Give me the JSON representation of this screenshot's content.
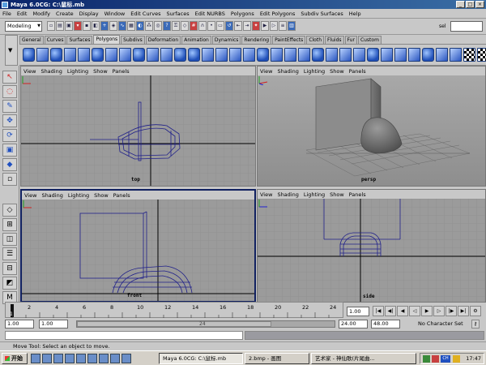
{
  "window": {
    "title": "Maya 6.0CG: C:\\鼠标.mb"
  },
  "menubar": [
    "File",
    "Edit",
    "Modify",
    "Create",
    "Display",
    "Window",
    "Edit Curves",
    "Surfaces",
    "Edit NURBS",
    "Polygons",
    "Edit Polygons",
    "Subdiv Surfaces",
    "Help"
  ],
  "statusline": {
    "mode": "Modeling",
    "selection_label": "sel"
  },
  "shelf": {
    "tabs": [
      "General",
      "Curves",
      "Surfaces",
      "Polygons",
      "Subdivs",
      "Deformation",
      "Animation",
      "Dynamics",
      "Rendering",
      "PaintEffects",
      "Cloth",
      "Fluids",
      "Fur",
      "Custom"
    ],
    "active_tab": "Polygons"
  },
  "viewport_menu": [
    "View",
    "Shading",
    "Lighting",
    "Show",
    "Panels"
  ],
  "viewports": {
    "top": {
      "camera": "top"
    },
    "persp": {
      "camera": "persp"
    },
    "front": {
      "camera": "front"
    },
    "side": {
      "camera": "side"
    }
  },
  "timeslider": {
    "ticks": [
      "2",
      "4",
      "6",
      "8",
      "10",
      "12",
      "14",
      "16",
      "18",
      "20",
      "22",
      "24"
    ],
    "current_time": "1.00",
    "current_frame": "1"
  },
  "rangeslider": {
    "start_time": "1.00",
    "playback_start": "1.00",
    "range_end_label": "24",
    "playback_end": "24.00",
    "end_time": "48.00",
    "character_set": "No Character Set"
  },
  "helpline": {
    "text": "Move Tool: Select an object to move."
  },
  "taskbar": {
    "start": "开始",
    "tasks": [
      "Maya 6.0CG: C:\\鼠标.mb",
      "2.bmp - 画图",
      "艺术家 - 神仙歌(片尾曲..."
    ],
    "tray_label": "CH",
    "clock": "17:47"
  },
  "colors": {
    "grid_bg": "#9b9b9b",
    "grid_line": "#8a8a8a",
    "wire": "#20208a",
    "active_border": "#102060"
  }
}
